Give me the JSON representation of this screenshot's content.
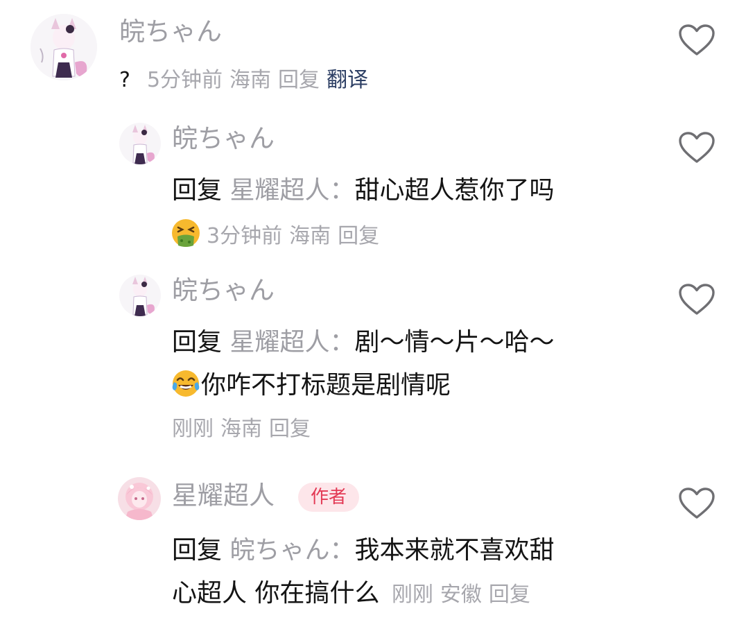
{
  "colors": {
    "username_gray": "#9e9ea4",
    "meta_gray": "#a7a7ad",
    "text_dark": "#141414",
    "translate_blue": "#2c3e63",
    "author_badge_text": "#e33a55",
    "author_badge_bg": "#fde6ea"
  },
  "comment": {
    "username": "皖ちゃん",
    "content": "?",
    "time": "5分钟前",
    "location": "海南",
    "reply_label": "回复",
    "translate_label": "翻译"
  },
  "replies": [
    {
      "username": "皖ちゃん",
      "reply_prefix": "回复",
      "reply_target": "星耀超人：",
      "line1": "甜心超人惹你了吗",
      "emoji": "nauseated-face-emoji",
      "time": "3分钟前",
      "location": "海南",
      "reply_label": "回复"
    },
    {
      "username": "皖ちゃん",
      "reply_prefix": "回复",
      "reply_target": "星耀超人：",
      "line1": "剧～情～片～哈～",
      "emoji": "tears-of-joy-emoji",
      "line2": "你咋不打标题是剧情呢",
      "time": "刚刚",
      "location": "海南",
      "reply_label": "回复"
    },
    {
      "username": "星耀超人",
      "badge": "作者",
      "reply_prefix": "回复",
      "reply_target": "皖ちゃん：",
      "line1": "我本来就不喜欢甜",
      "line2": "心超人 你在搞什么",
      "time": "刚刚",
      "location": "安徽",
      "reply_label": "回复"
    }
  ]
}
